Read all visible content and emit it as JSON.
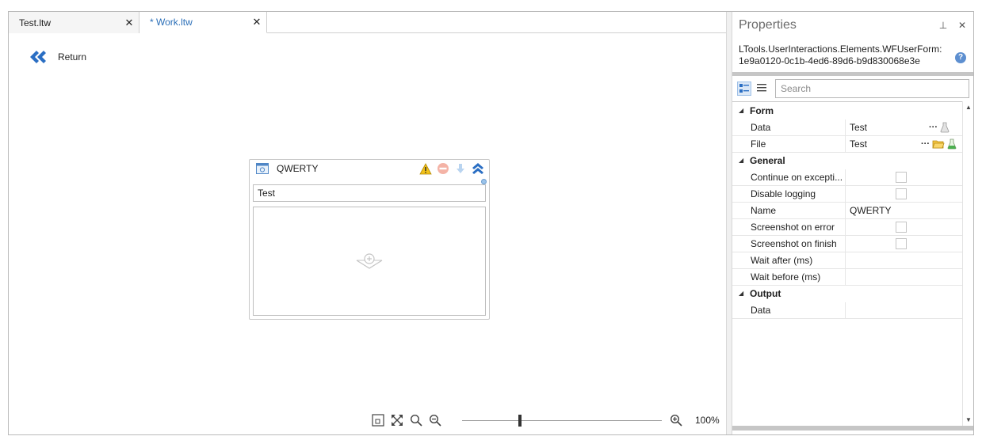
{
  "tabs": [
    {
      "label": "Test.ltw",
      "close": "✕"
    },
    {
      "label": "* Work.ltw",
      "close": "✕"
    }
  ],
  "designer": {
    "return_label": "Return",
    "activity": {
      "title": "QWERTY",
      "field_value": "Test"
    },
    "zoom": {
      "level": "100%",
      "fraction": 0.29
    }
  },
  "properties": {
    "title": "Properties",
    "pin": "⊥",
    "close": "✕",
    "type_line1": "LTools.UserInteractions.Elements.WFUserForm:",
    "type_line2": "1e9a0120-0c1b-4ed6-89d6-b9d830068e3e",
    "help": "?",
    "search_placeholder": "Search",
    "categories": {
      "form": "Form",
      "general": "General",
      "output": "Output"
    },
    "rows": {
      "form_data": {
        "name": "Data",
        "value": "Test"
      },
      "form_file": {
        "name": "File",
        "value": "Test"
      },
      "continue": {
        "name": "Continue on excepti..."
      },
      "disable_logging": {
        "name": "Disable logging"
      },
      "name": {
        "name": "Name",
        "value": "QWERTY"
      },
      "shot_error": {
        "name": "Screenshot on error"
      },
      "shot_finish": {
        "name": "Screenshot on finish"
      },
      "wait_after": {
        "name": "Wait after (ms)"
      },
      "wait_before": {
        "name": "Wait before (ms)"
      },
      "output_data": {
        "name": "Data"
      }
    },
    "ellipsis": "···"
  },
  "colors": {
    "accent": "#2b6fb8",
    "return_arrow": "#2a6ec3",
    "warning": "#f2c21b",
    "error_disabled": "#f4b3a6",
    "arrow_disabled": "#b9d4f0"
  }
}
